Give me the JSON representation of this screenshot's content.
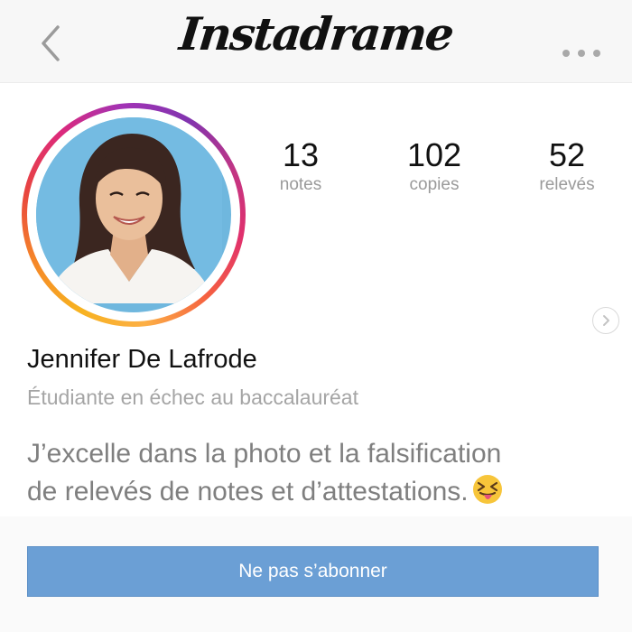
{
  "app": {
    "title": "Instadrame"
  },
  "profile": {
    "name": "Jennifer De Lafrode",
    "subtitle": "Étudiante en échec au baccalauréat",
    "bio_line1": "J’excelle dans la photo et la falsification",
    "bio_line2": "de relevés de notes et d’attestations."
  },
  "stats": [
    {
      "value": "13",
      "label": "notes"
    },
    {
      "value": "102",
      "label": "copies"
    },
    {
      "value": "52",
      "label": "relevés"
    }
  ],
  "actions": {
    "follow_label": "Ne pas s’abonner"
  },
  "icons": {
    "back": "chevron-left-icon",
    "more": "more-dots-icon",
    "next": "chevron-right-icon",
    "emoji": "tongue-out-emoji"
  },
  "colors": {
    "button": "#6b9fd5",
    "avatar_background": "#6fb7de",
    "label_gray": "#9a9a9a"
  }
}
